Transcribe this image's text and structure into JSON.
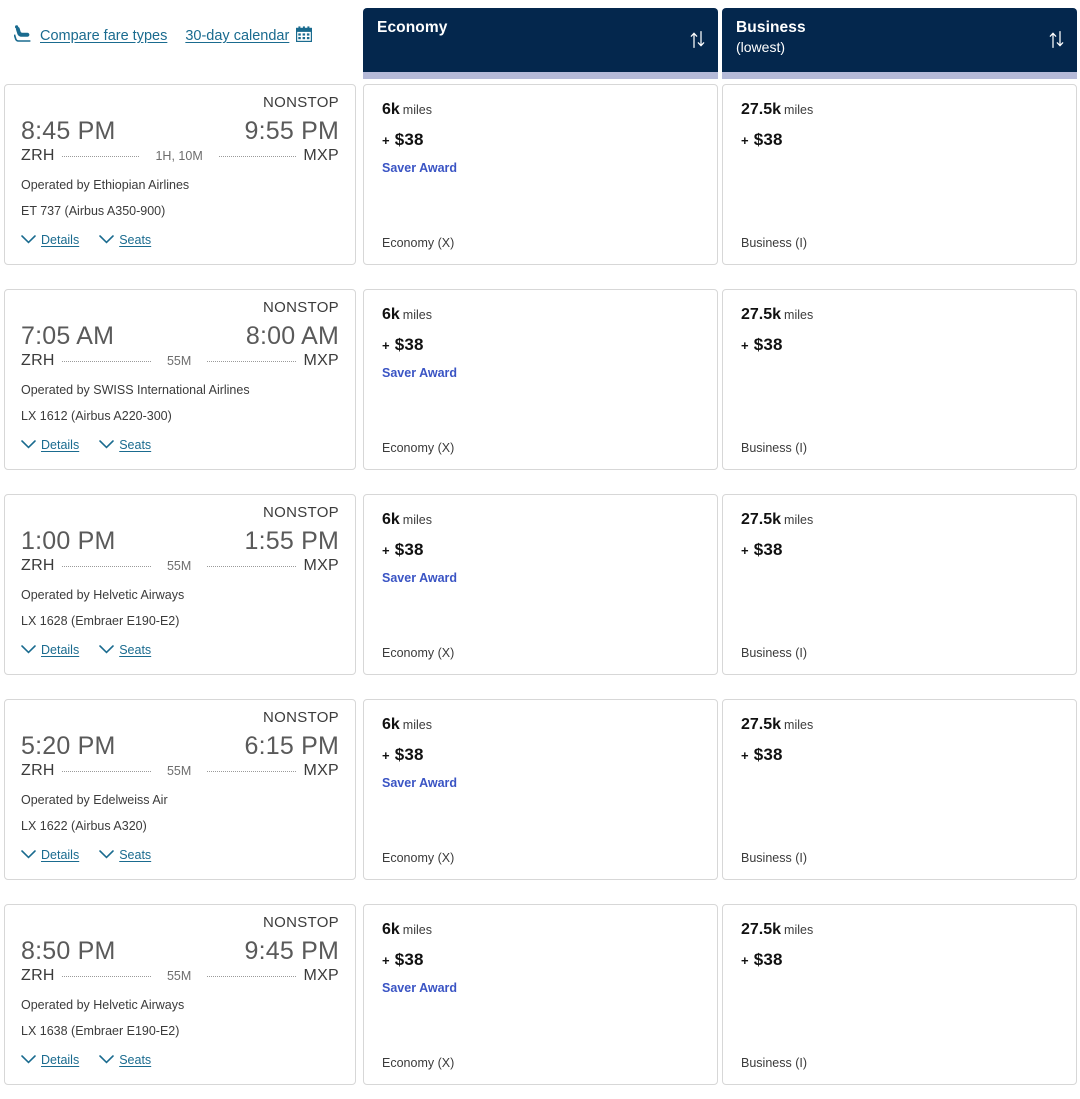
{
  "toolbar": {
    "links": [
      {
        "label": "Compare fare types",
        "icon": "seat-icon",
        "icon_position": "left"
      },
      {
        "label": "30-day calendar",
        "icon": "calendar-icon",
        "icon_position": "right"
      }
    ]
  },
  "columns": [
    {
      "key": "economy",
      "title": "Economy",
      "subtitle": "",
      "sort_icon": "sort-arrows-icon"
    },
    {
      "key": "business",
      "title": "Business",
      "subtitle": "(lowest)",
      "sort_icon": "sort-arrows-icon"
    }
  ],
  "colors": {
    "header_bg": "#04274d",
    "accent_bar": "#b5bad8",
    "link": "#1a6b8f",
    "award_label": "#3a54c4",
    "card_border": "#d7d7d7"
  },
  "actions": {
    "details_label": "Details",
    "seats_label": "Seats"
  },
  "flights": [
    {
      "stops": "NONSTOP",
      "depart_time": "8:45 PM",
      "arrive_time": "9:55 PM",
      "origin": "ZRH",
      "destination": "MXP",
      "duration": "1H, 10M",
      "operator": "Operated by Ethiopian Airlines",
      "equipment": "ET 737 (Airbus A350-900)",
      "fares": [
        {
          "miles": "6k",
          "miles_unit": "miles",
          "cash": "$38",
          "cash_prefix": "+",
          "award_label": "Saver Award",
          "cabin_code": "Economy (X)"
        },
        {
          "miles": "27.5k",
          "miles_unit": "miles",
          "cash": "$38",
          "cash_prefix": "+",
          "award_label": "",
          "cabin_code": "Business (I)"
        }
      ]
    },
    {
      "stops": "NONSTOP",
      "depart_time": "7:05 AM",
      "arrive_time": "8:00 AM",
      "origin": "ZRH",
      "destination": "MXP",
      "duration": "55M",
      "operator": "Operated by SWISS International Airlines",
      "equipment": "LX 1612 (Airbus A220-300)",
      "fares": [
        {
          "miles": "6k",
          "miles_unit": "miles",
          "cash": "$38",
          "cash_prefix": "+",
          "award_label": "Saver Award",
          "cabin_code": "Economy (X)"
        },
        {
          "miles": "27.5k",
          "miles_unit": "miles",
          "cash": "$38",
          "cash_prefix": "+",
          "award_label": "",
          "cabin_code": "Business (I)"
        }
      ]
    },
    {
      "stops": "NONSTOP",
      "depart_time": "1:00 PM",
      "arrive_time": "1:55 PM",
      "origin": "ZRH",
      "destination": "MXP",
      "duration": "55M",
      "operator": "Operated by Helvetic Airways",
      "equipment": "LX 1628 (Embraer E190-E2)",
      "fares": [
        {
          "miles": "6k",
          "miles_unit": "miles",
          "cash": "$38",
          "cash_prefix": "+",
          "award_label": "Saver Award",
          "cabin_code": "Economy (X)"
        },
        {
          "miles": "27.5k",
          "miles_unit": "miles",
          "cash": "$38",
          "cash_prefix": "+",
          "award_label": "",
          "cabin_code": "Business (I)"
        }
      ]
    },
    {
      "stops": "NONSTOP",
      "depart_time": "5:20 PM",
      "arrive_time": "6:15 PM",
      "origin": "ZRH",
      "destination": "MXP",
      "duration": "55M",
      "operator": "Operated by Edelweiss Air",
      "equipment": "LX 1622 (Airbus A320)",
      "fares": [
        {
          "miles": "6k",
          "miles_unit": "miles",
          "cash": "$38",
          "cash_prefix": "+",
          "award_label": "Saver Award",
          "cabin_code": "Economy (X)"
        },
        {
          "miles": "27.5k",
          "miles_unit": "miles",
          "cash": "$38",
          "cash_prefix": "+",
          "award_label": "",
          "cabin_code": "Business (I)"
        }
      ]
    },
    {
      "stops": "NONSTOP",
      "depart_time": "8:50 PM",
      "arrive_time": "9:45 PM",
      "origin": "ZRH",
      "destination": "MXP",
      "duration": "55M",
      "operator": "Operated by Helvetic Airways",
      "equipment": "LX 1638 (Embraer E190-E2)",
      "fares": [
        {
          "miles": "6k",
          "miles_unit": "miles",
          "cash": "$38",
          "cash_prefix": "+",
          "award_label": "Saver Award",
          "cabin_code": "Economy (X)"
        },
        {
          "miles": "27.5k",
          "miles_unit": "miles",
          "cash": "$38",
          "cash_prefix": "+",
          "award_label": "",
          "cabin_code": "Business (I)"
        }
      ]
    }
  ]
}
